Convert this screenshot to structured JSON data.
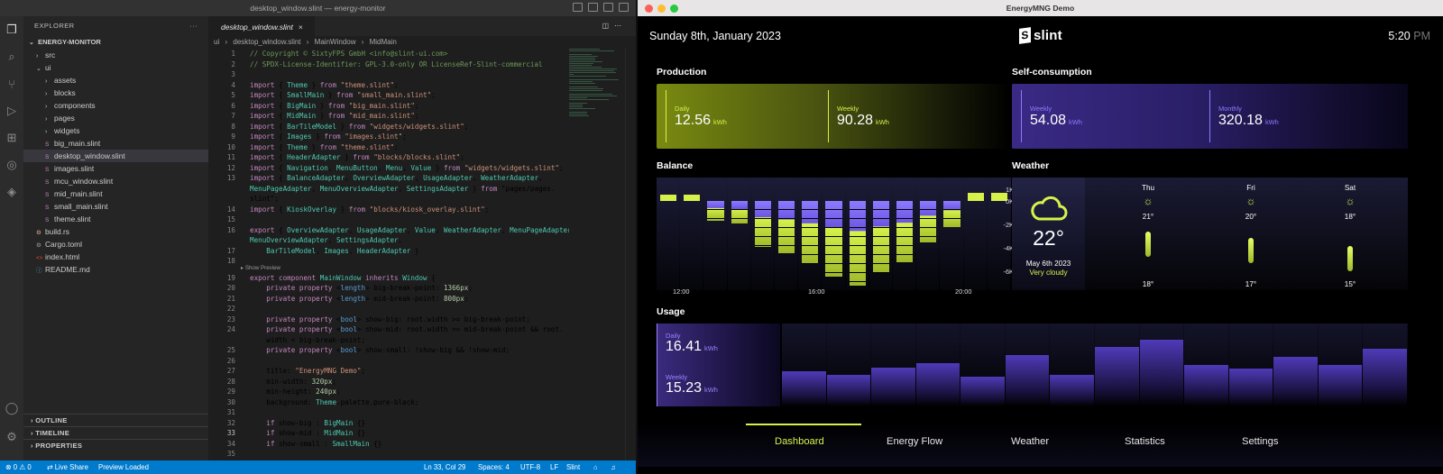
{
  "vscode": {
    "window_title": "desktop_window.slint — energy-monitor",
    "explorer_label": "EXPLORER",
    "explorer_more": "···",
    "project_name": "ENERGY-MONITOR",
    "tree": [
      {
        "label": "src",
        "depth": 1,
        "kind": "folder",
        "open": false
      },
      {
        "label": "ui",
        "depth": 1,
        "kind": "folder",
        "open": true
      },
      {
        "label": "assets",
        "depth": 2,
        "kind": "folder",
        "open": false
      },
      {
        "label": "blocks",
        "depth": 2,
        "kind": "folder",
        "open": false
      },
      {
        "label": "components",
        "depth": 2,
        "kind": "folder",
        "open": false
      },
      {
        "label": "pages",
        "depth": 2,
        "kind": "folder",
        "open": false
      },
      {
        "label": "widgets",
        "depth": 2,
        "kind": "folder",
        "open": false
      },
      {
        "label": "big_main.slint",
        "depth": 2,
        "kind": "file"
      },
      {
        "label": "desktop_window.slint",
        "depth": 2,
        "kind": "file",
        "selected": true
      },
      {
        "label": "images.slint",
        "depth": 2,
        "kind": "file"
      },
      {
        "label": "mcu_window.slint",
        "depth": 2,
        "kind": "file"
      },
      {
        "label": "mid_main.slint",
        "depth": 2,
        "kind": "file"
      },
      {
        "label": "small_main.slint",
        "depth": 2,
        "kind": "file"
      },
      {
        "label": "theme.slint",
        "depth": 2,
        "kind": "file"
      },
      {
        "label": "build.rs",
        "depth": 1,
        "kind": "rust"
      },
      {
        "label": "Cargo.toml",
        "depth": 1,
        "kind": "toml"
      },
      {
        "label": "index.html",
        "depth": 1,
        "kind": "html"
      },
      {
        "label": "README.md",
        "depth": 1,
        "kind": "md"
      }
    ],
    "sections": [
      "OUTLINE",
      "TIMELINE",
      "PROPERTIES"
    ],
    "tab_label": "desktop_window.slint",
    "tab_close": "×",
    "breadcrumb": [
      "ui",
      "›",
      "desktop_window.slint",
      "›",
      "MainWindow",
      "›",
      "MidMain"
    ],
    "show_preview": "▸ Show Preview",
    "code": [
      {
        "n": "1",
        "t": "// Copyright © SixtyFPS GmbH <info@slint-ui.com>",
        "c": "cm"
      },
      {
        "n": "2",
        "t": "// SPDX-License-Identifier: GPL-3.0-only OR LicenseRef-Slint-commercial",
        "c": "cm"
      },
      {
        "n": "3",
        "t": "",
        "c": "df"
      },
      {
        "n": "4",
        "t": "import { Theme } from \"theme.slint\";",
        "c": "df"
      },
      {
        "n": "5",
        "t": "import { SmallMain } from \"small_main.slint\";",
        "c": "df"
      },
      {
        "n": "6",
        "t": "import { BigMain } from \"big_main.slint\";",
        "c": "df"
      },
      {
        "n": "7",
        "t": "import { MidMain } from \"mid_main.slint\";",
        "c": "df"
      },
      {
        "n": "8",
        "t": "import { BarTileModel } from \"widgets/widgets.slint\";",
        "c": "df"
      },
      {
        "n": "9",
        "t": "import { Images } from \"images.slint\";",
        "c": "df"
      },
      {
        "n": "10",
        "t": "import { Theme } from \"theme.slint\";",
        "c": "df"
      },
      {
        "n": "11",
        "t": "import { HeaderAdapter } from \"blocks/blocks.slint\";",
        "c": "df"
      },
      {
        "n": "12",
        "t": "import { Navigation, MenuButton, Menu, Value } from \"widgets/widgets.slint\";",
        "c": "df"
      },
      {
        "n": "13",
        "t": "import { BalanceAdapter, OverviewAdapter, UsageAdapter, WeatherAdapter,",
        "c": "df"
      },
      {
        "n": "",
        "t": "MenuPageAdapter, MenuOverviewAdapter, SettingsAdapter } from \"pages/pages.",
        "c": "df"
      },
      {
        "n": "",
        "t": "slint\";",
        "c": "df"
      },
      {
        "n": "14",
        "t": "import { KioskOverlay } from \"blocks/kiosk_overlay.slint\";",
        "c": "df"
      },
      {
        "n": "15",
        "t": "",
        "c": "df"
      },
      {
        "n": "16",
        "t": "export { OverviewAdapter, UsageAdapter, Value, WeatherAdapter, MenuPageAdapter,",
        "c": "df"
      },
      {
        "n": "",
        "t": "MenuOverviewAdapter, SettingsAdapter,",
        "c": "df"
      },
      {
        "n": "17",
        "t": "    BarTileModel, Images, HeaderAdapter }",
        "c": "df"
      },
      {
        "n": "18",
        "t": "",
        "c": "df"
      },
      {
        "n": "19",
        "t": "export component MainWindow inherits Window {",
        "c": "df"
      },
      {
        "n": "20",
        "t": "    private property <length> big-break-point: 1366px;",
        "c": "df"
      },
      {
        "n": "21",
        "t": "    private property <length> mid-break-point: 800px;",
        "c": "df"
      },
      {
        "n": "22",
        "t": "",
        "c": "df"
      },
      {
        "n": "23",
        "t": "    private property <bool> show-big: root.width >= big-break-point;",
        "c": "df"
      },
      {
        "n": "24",
        "t": "    private property <bool> show-mid: root.width >= mid-break-point && root.",
        "c": "df"
      },
      {
        "n": "",
        "t": "    width < big-break-point;",
        "c": "df"
      },
      {
        "n": "25",
        "t": "    private property <bool> show-small: !show-big && !show-mid;",
        "c": "df"
      },
      {
        "n": "26",
        "t": "",
        "c": "df"
      },
      {
        "n": "27",
        "t": "    title: \"EnergyMNG Demo\";",
        "c": "df"
      },
      {
        "n": "28",
        "t": "    min-width: 320px;",
        "c": "df"
      },
      {
        "n": "29",
        "t": "    min-height: 240px;",
        "c": "df"
      },
      {
        "n": "30",
        "t": "    background: Theme.palette.pure-black;",
        "c": "df"
      },
      {
        "n": "31",
        "t": "",
        "c": "df"
      },
      {
        "n": "32",
        "t": "    if show-big : BigMain {}",
        "c": "df"
      },
      {
        "n": "33",
        "t": "    if show-mid : MidMain {}",
        "c": "df",
        "cur": true
      },
      {
        "n": "34",
        "t": "    if show-small : SmallMain {}",
        "c": "df"
      },
      {
        "n": "35",
        "t": "",
        "c": "df"
      }
    ],
    "status": {
      "problems": "⊗ 0  ⚠ 0",
      "live_share": "Live Share",
      "preview": "Preview Loaded",
      "position": "Ln 33, Col 29",
      "spaces": "Spaces: 4",
      "encoding": "UTF-8",
      "eol": "LF",
      "language": "Slint"
    }
  },
  "app": {
    "window_title": "EnergyMNG Demo",
    "date": "Sunday 8th, January 2023",
    "logo_text": "slint",
    "logo_mark": "S",
    "time": "5:20",
    "ampm": "PM",
    "production": {
      "title": "Production",
      "daily_label": "Daily",
      "daily_value": "12.56",
      "daily_unit": "kWh",
      "weekly_label": "Weekly",
      "weekly_value": "90.28",
      "weekly_unit": "kWh"
    },
    "self_consumption": {
      "title": "Self-consumption",
      "weekly_label": "Weekly",
      "weekly_value": "54.08",
      "weekly_unit": "kWh",
      "monthly_label": "Monthly",
      "monthly_value": "320.18",
      "monthly_unit": "kWh"
    },
    "balance": {
      "title": "Balance",
      "y_ticks": [
        "1K",
        "0K",
        "-2K",
        "-4K",
        "-6K"
      ],
      "x_ticks": [
        "12:00",
        "16:00",
        "20:00"
      ],
      "values": [
        0.25,
        0.25,
        -1.5,
        -1.7,
        -3.5,
        -4.0,
        -4.8,
        -5.8,
        -6.5,
        -5.5,
        -4.7,
        -3.2,
        -2.0,
        0.3,
        0.3
      ]
    },
    "weather": {
      "title": "Weather",
      "today_temp": "22°",
      "today_date": "May 6th 2023",
      "today_desc": "Very cloudy",
      "today_icon": "cloud-icon",
      "forecast": [
        {
          "day": "Thu",
          "icon": "sun-cloud-icon",
          "high": "21°",
          "low": "18°",
          "level": 0.75
        },
        {
          "day": "Fri",
          "icon": "sun-cloud-icon",
          "high": "20°",
          "low": "17°",
          "level": 0.5
        },
        {
          "day": "Sat",
          "icon": "sun-cloud-icon",
          "high": "18°",
          "low": "15°",
          "level": 0.2
        }
      ]
    },
    "usage": {
      "title": "Usage",
      "daily_label": "Daily",
      "daily_value": "16.41",
      "daily_unit": "kWh",
      "weekly_label": "Weekly",
      "weekly_value": "15.23",
      "weekly_unit": "kWh",
      "bars": [
        0.42,
        0.38,
        0.47,
        0.52,
        0.36,
        0.62,
        0.38,
        0.72,
        0.8,
        0.5,
        0.46,
        0.6,
        0.5,
        0.7
      ]
    },
    "nav": [
      "Dashboard",
      "Energy Flow",
      "Weather",
      "Statistics",
      "Settings"
    ],
    "colors": {
      "accent": "#d6f24a",
      "purple": "#8c7bff"
    }
  }
}
